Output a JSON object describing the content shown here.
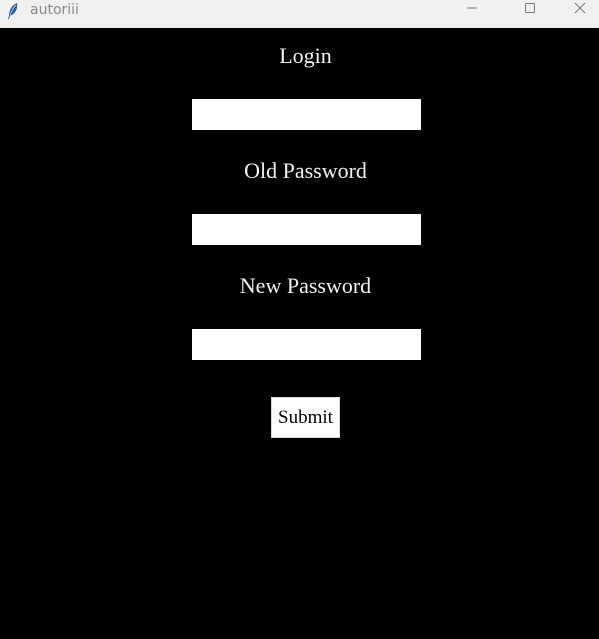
{
  "window": {
    "title": "autoriii",
    "icons": {
      "app": "feather-icon",
      "minimize": "minimize-icon",
      "maximize": "maximize-icon",
      "close": "close-icon"
    }
  },
  "form": {
    "login_label": "Login",
    "login_value": "",
    "old_password_label": "Old Password",
    "old_password_value": "",
    "new_password_label": "New Password",
    "new_password_value": "",
    "submit_label": "Submit"
  },
  "colors": {
    "background": "#000000",
    "label_text": "#f2f2f2",
    "field_background": "#ffffff",
    "titlebar": "#f0f0f0"
  }
}
